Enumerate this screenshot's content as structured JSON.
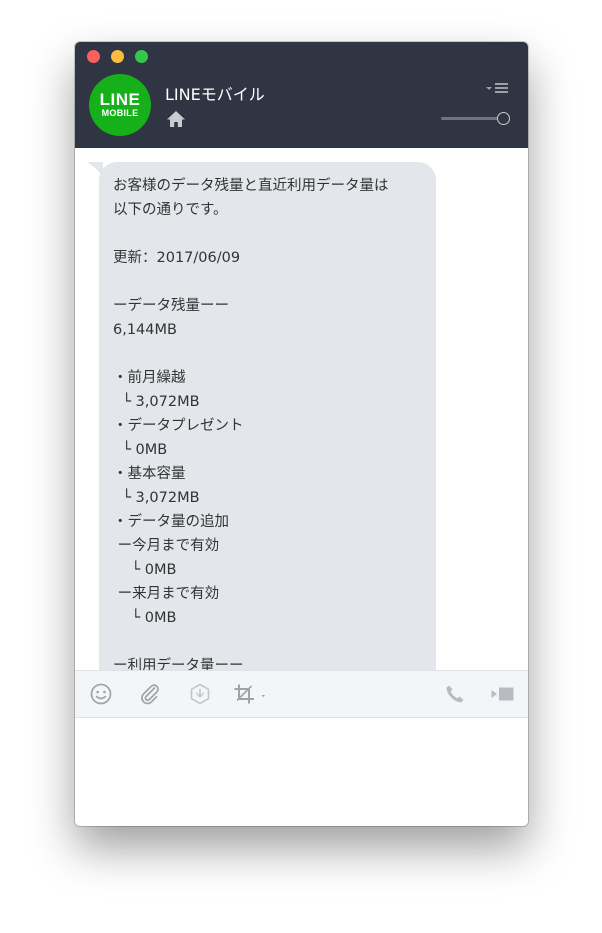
{
  "chat": {
    "title": "LINEモバイル",
    "logo_line1": "LINE",
    "logo_line2": "MOBILE"
  },
  "message": {
    "lines": [
      "お客様のデータ残量と直近利用データ量は",
      "以下の通りです。",
      "",
      "更新：2017/06/09",
      "",
      "ーデータ残量ーー",
      "6,144MB",
      "",
      "・前月繰越",
      "  └ 3,072MB",
      "・データプレゼント",
      "  └ 0MB",
      "・基本容量",
      "  └ 3,072MB",
      "・データ量の追加",
      " ー今月まで有効",
      "    └ 0MB",
      " ー来月まで有効",
      "    └ 0MB",
      "",
      "ー利用データ量ーー"
    ]
  },
  "colors": {
    "header_bg": "#2f3542",
    "logo_green": "#15b01a",
    "bubble_bg": "#e3e6ea",
    "toolbar_bg": "#f4f5f6"
  },
  "icons": {
    "header": [
      "home-icon",
      "menu-icon"
    ],
    "toolbar": [
      "emoji-icon",
      "attachment-icon",
      "download-icon",
      "crop-icon",
      "phone-icon",
      "video-call-icon"
    ]
  }
}
